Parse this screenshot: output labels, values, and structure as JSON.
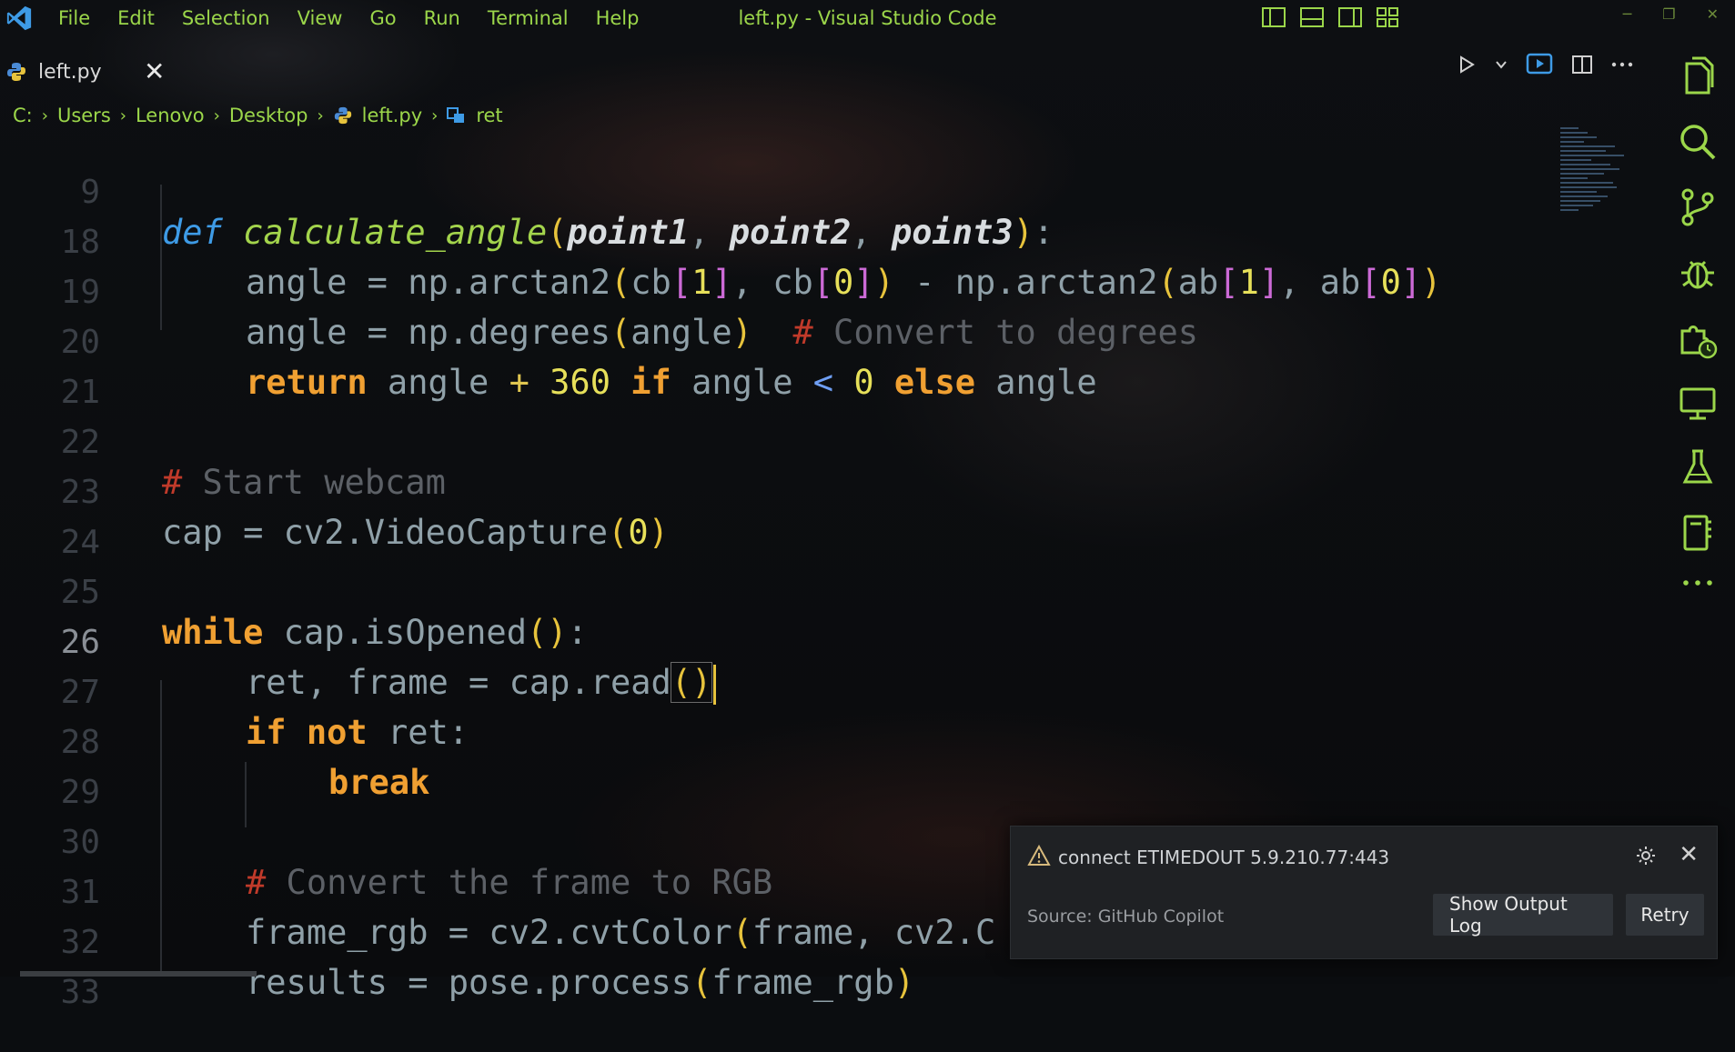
{
  "app": {
    "window_title": "left.py - Visual Studio Code",
    "accent_color": "#9bd64a"
  },
  "menu": [
    "File",
    "Edit",
    "Selection",
    "View",
    "Go",
    "Run",
    "Terminal",
    "Help"
  ],
  "tab": {
    "label": "left.py",
    "close": "✕",
    "icon": "python-icon"
  },
  "breadcrumb": [
    "C:",
    "Users",
    "Lenovo",
    "Desktop",
    "left.py",
    "ret"
  ],
  "editor": {
    "active_line": 26,
    "lines": [
      {
        "n": "9"
      },
      {
        "n": "18"
      },
      {
        "n": "19"
      },
      {
        "n": "20"
      },
      {
        "n": "21"
      },
      {
        "n": "22"
      },
      {
        "n": "23"
      },
      {
        "n": "24"
      },
      {
        "n": "25"
      },
      {
        "n": "26"
      },
      {
        "n": "27"
      },
      {
        "n": "28"
      },
      {
        "n": "29"
      },
      {
        "n": "30"
      },
      {
        "n": "31"
      },
      {
        "n": "32"
      },
      {
        "n": "33"
      }
    ]
  },
  "activity_bar": [
    "explorer-icon",
    "search-icon",
    "source-control-icon",
    "run-debug-icon",
    "extensions-icon",
    "remote-explorer-icon",
    "testing-icon",
    "notebook-icon",
    "more-icon"
  ],
  "notification": {
    "message": "connect ETIMEDOUT 5.9.210.77:443",
    "source": "Source: GitHub Copilot",
    "primary_button": "Show Output Log",
    "secondary_button": "Retry",
    "close": "✕"
  }
}
